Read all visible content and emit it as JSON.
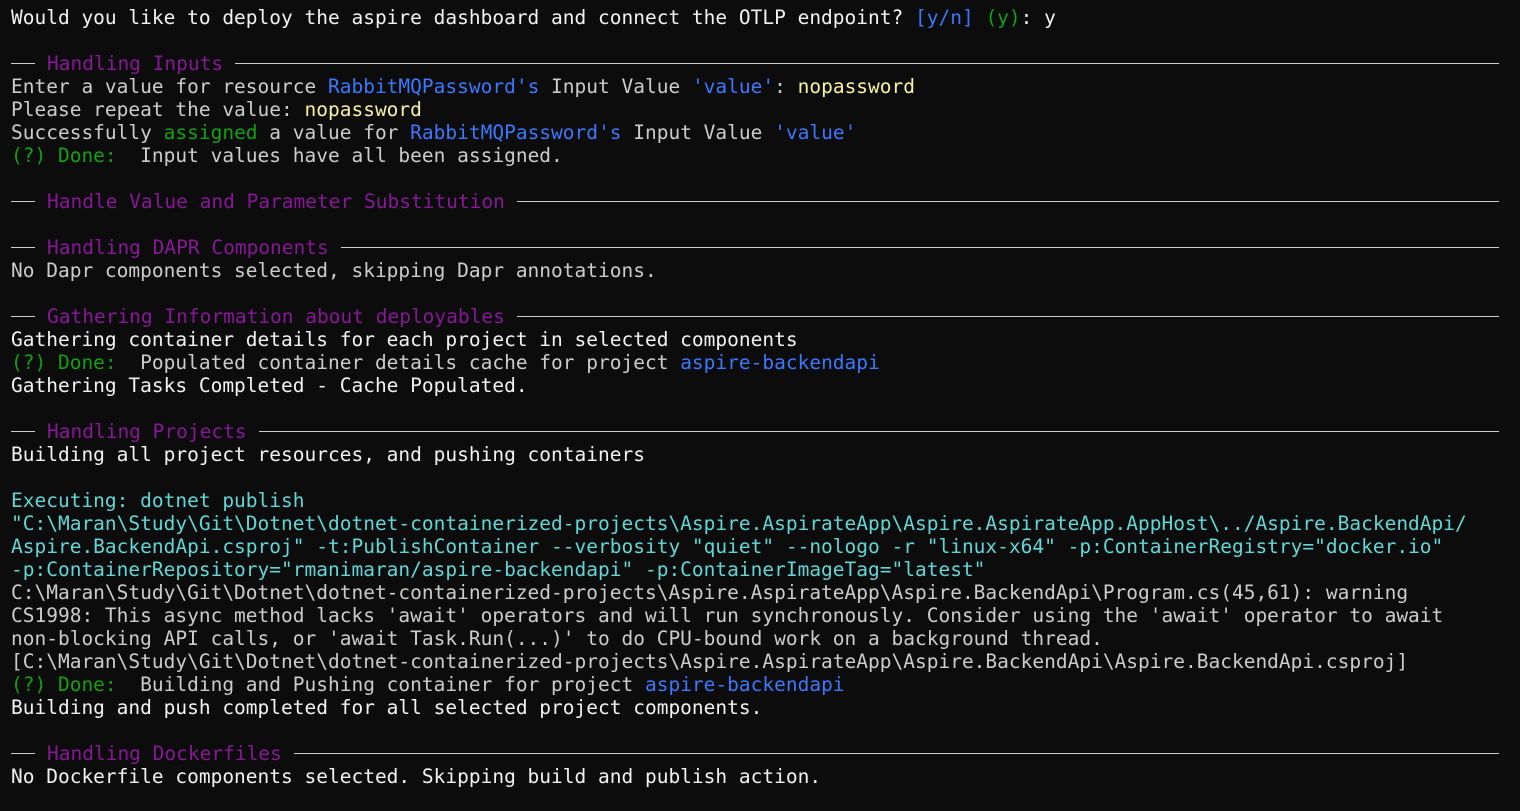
{
  "colors": {
    "background": "#0c0c0c",
    "text": "#cccccc",
    "section_title": "#881798",
    "resource_blue": "#3b78ff",
    "success_green": "#13a10e",
    "input_yellow": "#f9f1a5",
    "command_teal": "#61d6d6"
  },
  "prompt": {
    "question": "Would you like to deploy the aspire dashboard and connect the OTLP endpoint? ",
    "choices": "[y/n]",
    "default": "(y)",
    "colon": ": ",
    "answer": "y"
  },
  "sections": {
    "inputs": {
      "title": "Handling Inputs",
      "enter_prefix": "Enter a value for resource ",
      "resource": "RabbitMQPassword's",
      "input_value_text": " Input Value ",
      "value_key": "'value'",
      "colon": ": ",
      "entered_value": "nopassword",
      "repeat_prompt": "Please repeat the value: ",
      "repeat_value": "nopassword",
      "success_prefix": "Successfully ",
      "assigned_word": "assigned",
      "success_mid": " a value for ",
      "success_resource": "RabbitMQPassword's",
      "success_input_value": " Input Value ",
      "success_value_key": "'value'",
      "done_label": "(?) Done: ",
      "done_text": " Input values have all been assigned."
    },
    "substitution": {
      "title": "Handle Value and Parameter Substitution"
    },
    "dapr": {
      "title": "Handling DAPR Components",
      "message": "No Dapr components selected, skipping Dapr annotations."
    },
    "gathering": {
      "title": "Gathering Information about deployables",
      "line1": "Gathering container details for each project in selected components",
      "done_label": "(?) Done: ",
      "done_text": " Populated container details cache for project ",
      "project": "aspire-backendapi",
      "line3": "Gathering Tasks Completed - Cache Populated."
    },
    "projects": {
      "title": "Handling Projects",
      "line1": "Building all project resources, and pushing containers",
      "exec_line1": "Executing: dotnet publish",
      "exec_line2": "\"C:\\Maran\\Study\\Git\\Dotnet\\dotnet-containerized-projects\\Aspire.AspirateApp\\Aspire.AspirateApp.AppHost\\../Aspire.BackendApi/",
      "exec_line3": "Aspire.BackendApi.csproj\" -t:PublishContainer --verbosity \"quiet\" --nologo -r \"linux-x64\" -p:ContainerRegistry=\"docker.io\"",
      "exec_line4": "-p:ContainerRepository=\"rmanimaran/aspire-backendapi\" -p:ContainerImageTag=\"latest\"",
      "warn_line1": "C:\\Maran\\Study\\Git\\Dotnet\\dotnet-containerized-projects\\Aspire.AspirateApp\\Aspire.BackendApi\\Program.cs(45,61): warning",
      "warn_line2": "CS1998: This async method lacks 'await' operators and will run synchronously. Consider using the 'await' operator to await",
      "warn_line3": "non-blocking API calls, or 'await Task.Run(...)' to do CPU-bound work on a background thread.",
      "warn_line4": "[C:\\Maran\\Study\\Git\\Dotnet\\dotnet-containerized-projects\\Aspire.AspirateApp\\Aspire.BackendApi\\Aspire.BackendApi.csproj]",
      "done_label": "(?) Done: ",
      "done_text": " Building and Pushing container for project ",
      "project": "aspire-backendapi",
      "final_line": "Building and push completed for all selected project components."
    },
    "dockerfiles": {
      "title": "Handling Dockerfiles",
      "message": "No Dockerfile components selected. Skipping build and publish action."
    }
  }
}
